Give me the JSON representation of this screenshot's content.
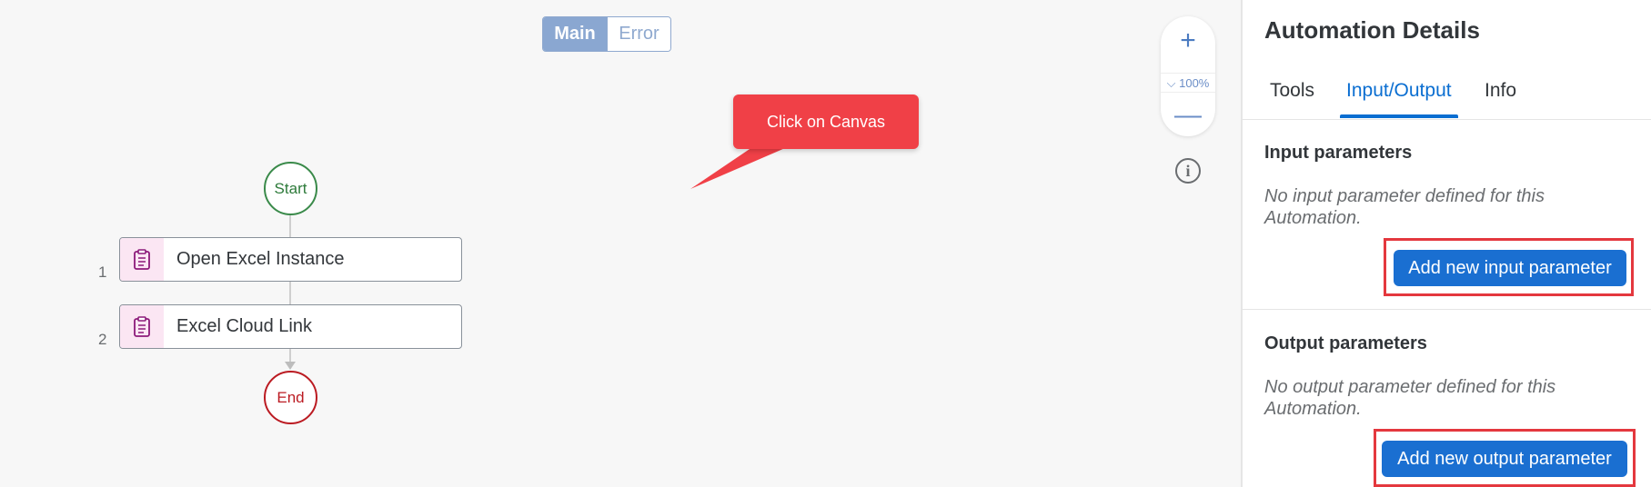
{
  "canvas": {
    "segmented": {
      "main": "Main",
      "error": "Error"
    },
    "zoom": {
      "plus": "+",
      "level": "⌵ 100%",
      "minus": "—"
    },
    "info_icon": "i",
    "callout": "Click on Canvas",
    "flow": {
      "start": "Start",
      "end": "End",
      "steps": [
        {
          "number": "1",
          "label": "Open Excel Instance",
          "icon": "clipboard-icon"
        },
        {
          "number": "2",
          "label": "Excel Cloud Link",
          "icon": "clipboard-icon"
        }
      ]
    }
  },
  "panel": {
    "title": "Automation Details",
    "tabs": [
      "Tools",
      "Input/Output",
      "Info"
    ],
    "active_tab": "Input/Output",
    "input": {
      "title": "Input parameters",
      "empty_text": "No input parameter defined for this Automation.",
      "button": "Add new input parameter"
    },
    "output": {
      "title": "Output parameters",
      "empty_text": "No output parameter defined for this Automation.",
      "button": "Add new output parameter"
    }
  },
  "colors": {
    "accent": "#0a6ed1",
    "button": "#1a6fd1",
    "highlight": "#e4383e",
    "callout": "#f04047",
    "start": "#3a8a4a",
    "end": "#bb1b22"
  }
}
